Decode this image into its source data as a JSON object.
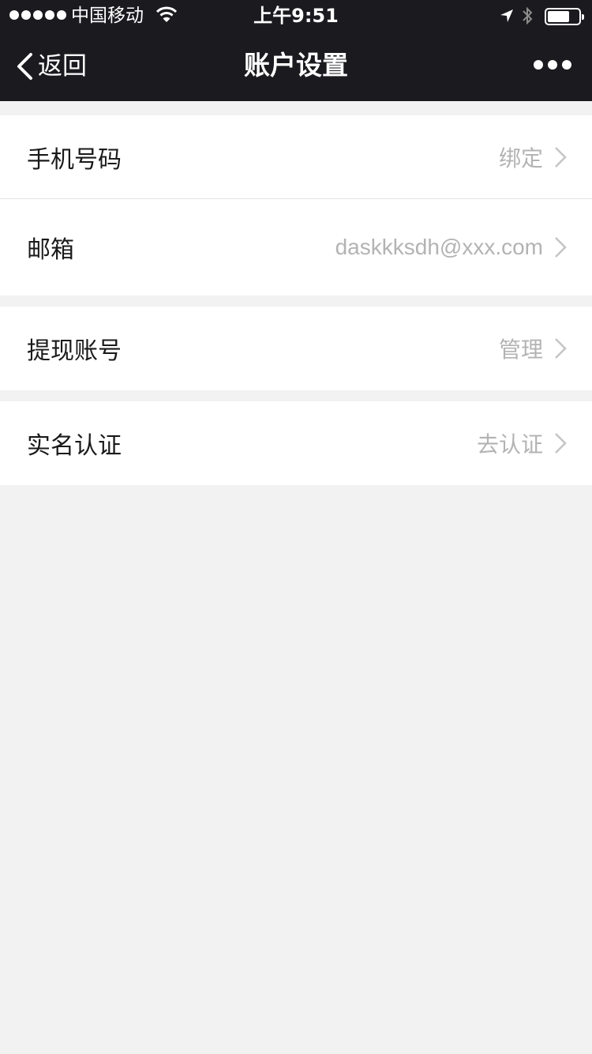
{
  "status_bar": {
    "carrier": "中国移动",
    "time": "上午9:51",
    "icons": [
      "signal-dots-icon",
      "wifi-icon",
      "location-arrow-icon",
      "bluetooth-icon",
      "battery-icon"
    ]
  },
  "nav": {
    "back_label": "返回",
    "title": "账户设置",
    "icons": [
      "chevron-left-icon",
      "more-dots-icon"
    ]
  },
  "settings": [
    {
      "label": "手机号码",
      "value": "绑定"
    },
    {
      "label": "邮箱",
      "value": "daskkksdh@xxx.com"
    },
    {
      "label": "提现账号",
      "value": "管理"
    },
    {
      "label": "实名认证",
      "value": "去认证"
    }
  ],
  "colors": {
    "nav_bg": "#1b1a1f",
    "page_bg": "#f2f2f2",
    "value_text": "#b3b3b3"
  }
}
